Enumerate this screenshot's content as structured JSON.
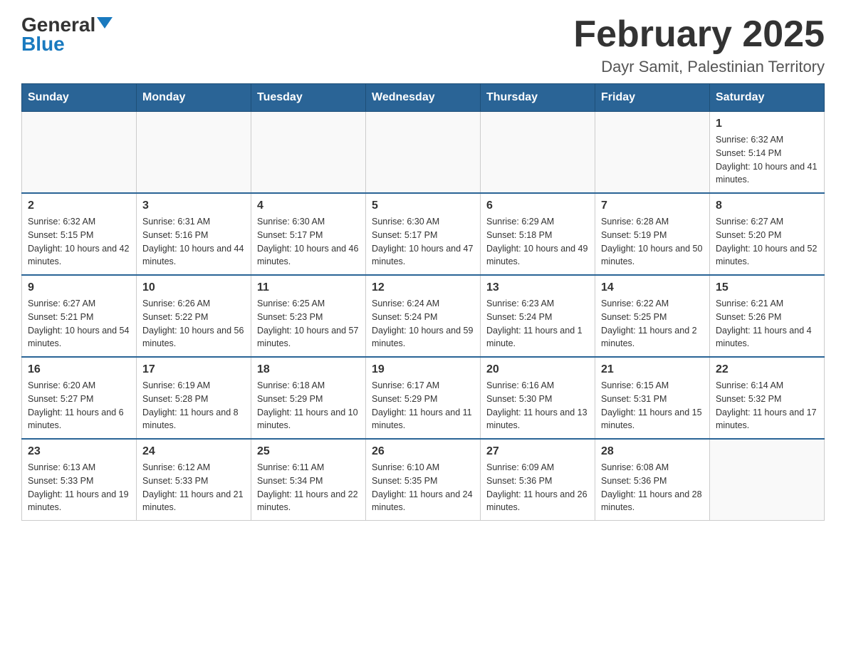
{
  "header": {
    "logo_general": "General",
    "logo_blue": "Blue",
    "month_title": "February 2025",
    "location": "Dayr Samit, Palestinian Territory"
  },
  "days_of_week": [
    "Sunday",
    "Monday",
    "Tuesday",
    "Wednesday",
    "Thursday",
    "Friday",
    "Saturday"
  ],
  "weeks": [
    [
      {
        "day": "",
        "sunrise": "",
        "sunset": "",
        "daylight": ""
      },
      {
        "day": "",
        "sunrise": "",
        "sunset": "",
        "daylight": ""
      },
      {
        "day": "",
        "sunrise": "",
        "sunset": "",
        "daylight": ""
      },
      {
        "day": "",
        "sunrise": "",
        "sunset": "",
        "daylight": ""
      },
      {
        "day": "",
        "sunrise": "",
        "sunset": "",
        "daylight": ""
      },
      {
        "day": "",
        "sunrise": "",
        "sunset": "",
        "daylight": ""
      },
      {
        "day": "1",
        "sunrise": "Sunrise: 6:32 AM",
        "sunset": "Sunset: 5:14 PM",
        "daylight": "Daylight: 10 hours and 41 minutes."
      }
    ],
    [
      {
        "day": "2",
        "sunrise": "Sunrise: 6:32 AM",
        "sunset": "Sunset: 5:15 PM",
        "daylight": "Daylight: 10 hours and 42 minutes."
      },
      {
        "day": "3",
        "sunrise": "Sunrise: 6:31 AM",
        "sunset": "Sunset: 5:16 PM",
        "daylight": "Daylight: 10 hours and 44 minutes."
      },
      {
        "day": "4",
        "sunrise": "Sunrise: 6:30 AM",
        "sunset": "Sunset: 5:17 PM",
        "daylight": "Daylight: 10 hours and 46 minutes."
      },
      {
        "day": "5",
        "sunrise": "Sunrise: 6:30 AM",
        "sunset": "Sunset: 5:17 PM",
        "daylight": "Daylight: 10 hours and 47 minutes."
      },
      {
        "day": "6",
        "sunrise": "Sunrise: 6:29 AM",
        "sunset": "Sunset: 5:18 PM",
        "daylight": "Daylight: 10 hours and 49 minutes."
      },
      {
        "day": "7",
        "sunrise": "Sunrise: 6:28 AM",
        "sunset": "Sunset: 5:19 PM",
        "daylight": "Daylight: 10 hours and 50 minutes."
      },
      {
        "day": "8",
        "sunrise": "Sunrise: 6:27 AM",
        "sunset": "Sunset: 5:20 PM",
        "daylight": "Daylight: 10 hours and 52 minutes."
      }
    ],
    [
      {
        "day": "9",
        "sunrise": "Sunrise: 6:27 AM",
        "sunset": "Sunset: 5:21 PM",
        "daylight": "Daylight: 10 hours and 54 minutes."
      },
      {
        "day": "10",
        "sunrise": "Sunrise: 6:26 AM",
        "sunset": "Sunset: 5:22 PM",
        "daylight": "Daylight: 10 hours and 56 minutes."
      },
      {
        "day": "11",
        "sunrise": "Sunrise: 6:25 AM",
        "sunset": "Sunset: 5:23 PM",
        "daylight": "Daylight: 10 hours and 57 minutes."
      },
      {
        "day": "12",
        "sunrise": "Sunrise: 6:24 AM",
        "sunset": "Sunset: 5:24 PM",
        "daylight": "Daylight: 10 hours and 59 minutes."
      },
      {
        "day": "13",
        "sunrise": "Sunrise: 6:23 AM",
        "sunset": "Sunset: 5:24 PM",
        "daylight": "Daylight: 11 hours and 1 minute."
      },
      {
        "day": "14",
        "sunrise": "Sunrise: 6:22 AM",
        "sunset": "Sunset: 5:25 PM",
        "daylight": "Daylight: 11 hours and 2 minutes."
      },
      {
        "day": "15",
        "sunrise": "Sunrise: 6:21 AM",
        "sunset": "Sunset: 5:26 PM",
        "daylight": "Daylight: 11 hours and 4 minutes."
      }
    ],
    [
      {
        "day": "16",
        "sunrise": "Sunrise: 6:20 AM",
        "sunset": "Sunset: 5:27 PM",
        "daylight": "Daylight: 11 hours and 6 minutes."
      },
      {
        "day": "17",
        "sunrise": "Sunrise: 6:19 AM",
        "sunset": "Sunset: 5:28 PM",
        "daylight": "Daylight: 11 hours and 8 minutes."
      },
      {
        "day": "18",
        "sunrise": "Sunrise: 6:18 AM",
        "sunset": "Sunset: 5:29 PM",
        "daylight": "Daylight: 11 hours and 10 minutes."
      },
      {
        "day": "19",
        "sunrise": "Sunrise: 6:17 AM",
        "sunset": "Sunset: 5:29 PM",
        "daylight": "Daylight: 11 hours and 11 minutes."
      },
      {
        "day": "20",
        "sunrise": "Sunrise: 6:16 AM",
        "sunset": "Sunset: 5:30 PM",
        "daylight": "Daylight: 11 hours and 13 minutes."
      },
      {
        "day": "21",
        "sunrise": "Sunrise: 6:15 AM",
        "sunset": "Sunset: 5:31 PM",
        "daylight": "Daylight: 11 hours and 15 minutes."
      },
      {
        "day": "22",
        "sunrise": "Sunrise: 6:14 AM",
        "sunset": "Sunset: 5:32 PM",
        "daylight": "Daylight: 11 hours and 17 minutes."
      }
    ],
    [
      {
        "day": "23",
        "sunrise": "Sunrise: 6:13 AM",
        "sunset": "Sunset: 5:33 PM",
        "daylight": "Daylight: 11 hours and 19 minutes."
      },
      {
        "day": "24",
        "sunrise": "Sunrise: 6:12 AM",
        "sunset": "Sunset: 5:33 PM",
        "daylight": "Daylight: 11 hours and 21 minutes."
      },
      {
        "day": "25",
        "sunrise": "Sunrise: 6:11 AM",
        "sunset": "Sunset: 5:34 PM",
        "daylight": "Daylight: 11 hours and 22 minutes."
      },
      {
        "day": "26",
        "sunrise": "Sunrise: 6:10 AM",
        "sunset": "Sunset: 5:35 PM",
        "daylight": "Daylight: 11 hours and 24 minutes."
      },
      {
        "day": "27",
        "sunrise": "Sunrise: 6:09 AM",
        "sunset": "Sunset: 5:36 PM",
        "daylight": "Daylight: 11 hours and 26 minutes."
      },
      {
        "day": "28",
        "sunrise": "Sunrise: 6:08 AM",
        "sunset": "Sunset: 5:36 PM",
        "daylight": "Daylight: 11 hours and 28 minutes."
      },
      {
        "day": "",
        "sunrise": "",
        "sunset": "",
        "daylight": ""
      }
    ]
  ]
}
